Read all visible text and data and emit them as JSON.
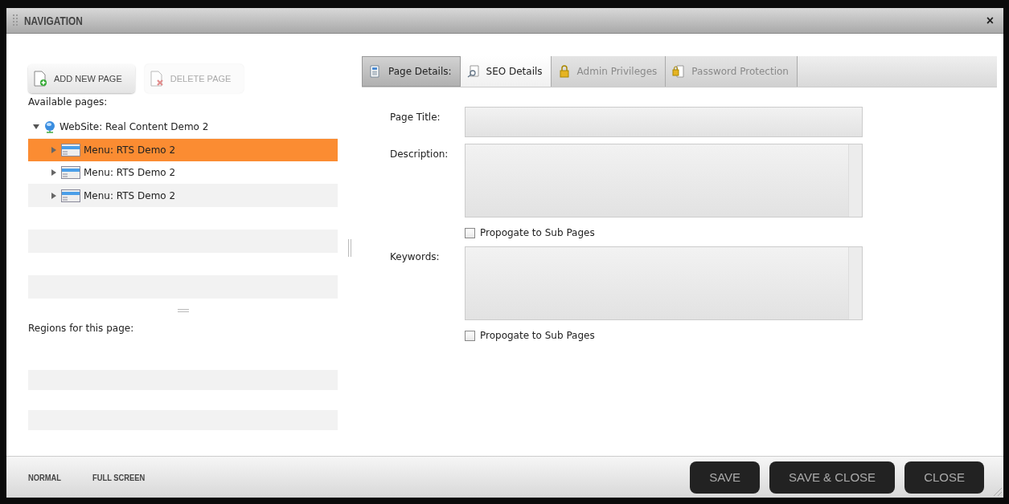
{
  "window": {
    "title": "NAVIGATION",
    "close": "×"
  },
  "toolbar": [
    {
      "label": "ADD NEW PAGE",
      "kind": "add",
      "disabled": false
    },
    {
      "label": "DELETE PAGE",
      "kind": "delete",
      "disabled": true
    }
  ],
  "pages": {
    "label": "Available pages:",
    "tree": [
      {
        "label": "WebSite: Real Content Demo 2",
        "kind": "site",
        "expanded": true,
        "selected": false,
        "children": [
          {
            "label": "Menu: RTS Demo 2",
            "kind": "menu",
            "expanded": false,
            "selected": true
          },
          {
            "label": "Menu: RTS Demo 2",
            "kind": "menu",
            "expanded": false,
            "selected": false
          },
          {
            "label": "Menu: RTS Demo 2",
            "kind": "menu",
            "expanded": false,
            "selected": false
          }
        ]
      }
    ]
  },
  "regions": {
    "label": "Regions for this page:"
  },
  "tabs": [
    {
      "label": "Page Details:",
      "kind": "page",
      "selected": false,
      "disabled": false
    },
    {
      "label": "SEO Details",
      "kind": "seo",
      "selected": true,
      "disabled": false
    },
    {
      "label": "Admin Privileges",
      "kind": "lock",
      "selected": false,
      "disabled": true
    },
    {
      "label": "Password Protection",
      "kind": "password",
      "selected": false,
      "disabled": true
    }
  ],
  "form": [
    {
      "label": "Page Title:",
      "kind": "text"
    },
    {
      "label": "Description:",
      "kind": "textarea",
      "propagate": {
        "label": "Propogate to Sub Pages",
        "checked": false
      }
    },
    {
      "label": "Keywords:",
      "kind": "textarea",
      "propagate": {
        "label": "Propogate to Sub Pages",
        "checked": false
      }
    }
  ],
  "view_modes": [
    "NORMAL",
    "FULL SCREEN"
  ],
  "buttons": [
    "SAVE",
    "SAVE & CLOSE",
    "CLOSE"
  ]
}
